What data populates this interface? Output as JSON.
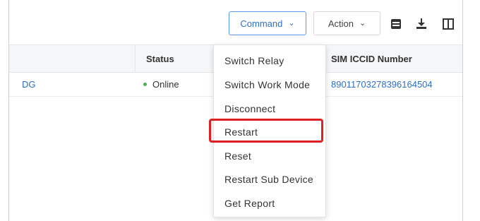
{
  "toolbar": {
    "command_label": "Command",
    "action_label": "Action",
    "icons": [
      "print-icon",
      "download-icon",
      "columns-icon"
    ]
  },
  "table": {
    "columns": [
      "Status",
      "SIM ICCID Number"
    ],
    "rows": [
      {
        "name": "DG",
        "status": "Online",
        "iccid": "89011703278396164504"
      }
    ]
  },
  "command_menu": {
    "items": [
      "Switch Relay",
      "Switch Work Mode",
      "Disconnect",
      "Restart",
      "Reset",
      "Restart Sub Device",
      "Get Report"
    ],
    "highlighted": "Restart"
  },
  "colors": {
    "accent": "#2f6fc8",
    "online": "#4caf50",
    "highlight_border": "#e02020"
  }
}
